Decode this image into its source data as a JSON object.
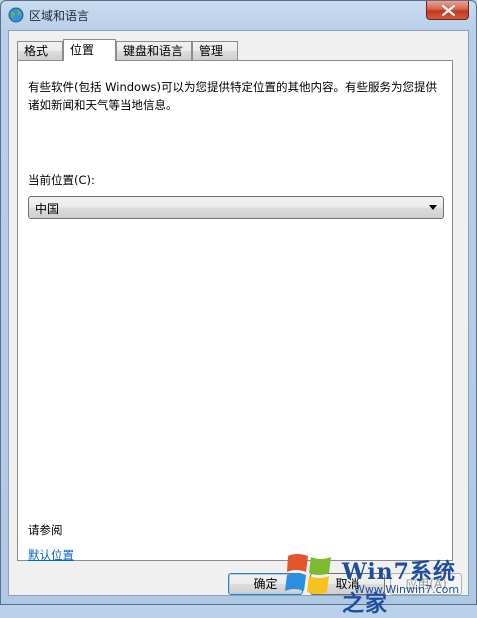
{
  "window": {
    "title": "区域和语言"
  },
  "tabs": [
    {
      "label": "格式"
    },
    {
      "label": "位置",
      "active": true
    },
    {
      "label": "键盘和语言"
    },
    {
      "label": "管理"
    }
  ],
  "panel": {
    "description": "有些软件(包括 Windows)可以为您提供特定位置的其他内容。有些服务为您提供诸如新闻和天气等当地信息。",
    "current_location_label": "当前位置(C):",
    "current_location_value": "中国",
    "see_also": "请参阅",
    "default_location_link": "默认位置"
  },
  "buttons": {
    "ok": "确定",
    "cancel": "取消",
    "apply": "应用(A)"
  },
  "watermark": {
    "brand": "Win7系统之家",
    "url": "Www.Winwin7.com"
  },
  "colors": {
    "link": "#0066cc",
    "close_button": "#c0391f",
    "watermark": "#1f4e9c"
  }
}
